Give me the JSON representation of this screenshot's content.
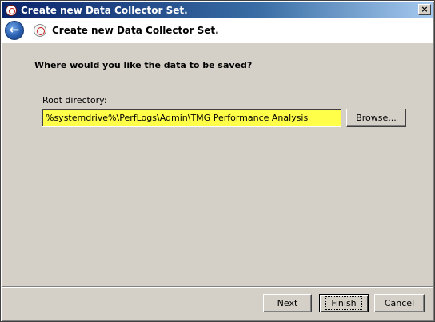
{
  "window": {
    "title": "Create new Data Collector Set.",
    "title_icon": "performance-monitor-icon",
    "close_label": "×"
  },
  "header": {
    "back_icon": "back-arrow-icon",
    "back_glyph": "←",
    "title": "Create new Data Collector Set."
  },
  "main": {
    "question": "Where would you like the data to be saved?",
    "root_directory_label": "Root directory:",
    "root_directory_value": "%systemdrive%\\PerfLogs\\Admin\\TMG Performance Analysis",
    "browse_label": "Browse..."
  },
  "footer": {
    "next_label": "Next",
    "finish_label": "Finish",
    "cancel_label": "Cancel"
  },
  "colors": {
    "highlight_input": "#ffff4a",
    "titlebar_start": "#0a246a",
    "face": "#d4d0c8"
  }
}
